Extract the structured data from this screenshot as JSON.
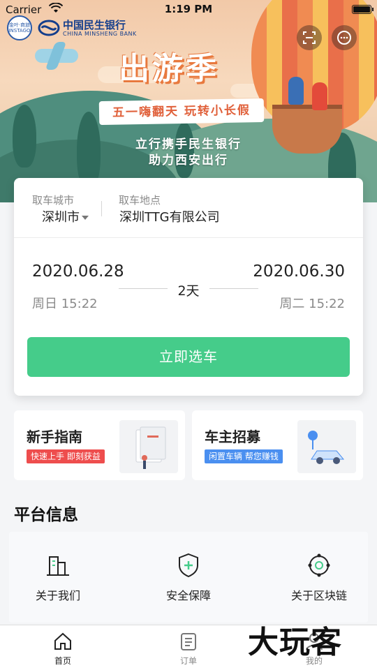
{
  "status_bar": {
    "carrier": "Carrier",
    "time": "1:19 PM"
  },
  "banner": {
    "seal_text": "金叶·商旅 INSTAGO",
    "bank_name_cn": "中国民生银行",
    "bank_name_en": "CHINA MINSHENG BANK",
    "title": "出游季",
    "ribbon": "五一嗨翻天 玩转小长假",
    "subtitle_line1": "立行携手民生银行",
    "subtitle_line2": "助力西安出行"
  },
  "top_icons": [
    "scan-icon",
    "message-icon"
  ],
  "booking": {
    "pickup_city_label": "取车城市",
    "pickup_city": "深圳市",
    "pickup_location_label": "取车地点",
    "pickup_location": "深圳TTG有限公司",
    "start_date": "2020.06.28",
    "start_day": "周日 15:22",
    "duration": "2天",
    "end_date": "2020.06.30",
    "end_day": "周二 15:22",
    "select_button": "立即选车",
    "button_color": "#45cc8a"
  },
  "promos": [
    {
      "title": "新手指南",
      "tag": "快速上手 即刻获益",
      "tag_color": "#ee4d4d"
    },
    {
      "title": "车主招募",
      "tag": "闲置车辆 帮您赚钱",
      "tag_color": "#4a8ff0"
    }
  ],
  "platform": {
    "title": "平台信息",
    "items": [
      {
        "label": "关于我们",
        "icon": "building-icon"
      },
      {
        "label": "安全保障",
        "icon": "shield-plus-icon"
      },
      {
        "label": "关于区块链",
        "icon": "blockchain-icon"
      }
    ]
  },
  "tabs": [
    {
      "label": "首页",
      "icon": "home-icon",
      "active": true
    },
    {
      "label": "订单",
      "icon": "order-list-icon",
      "active": false
    },
    {
      "label": "我的",
      "icon": "profile-icon",
      "active": false
    }
  ],
  "watermark": "大玩客"
}
